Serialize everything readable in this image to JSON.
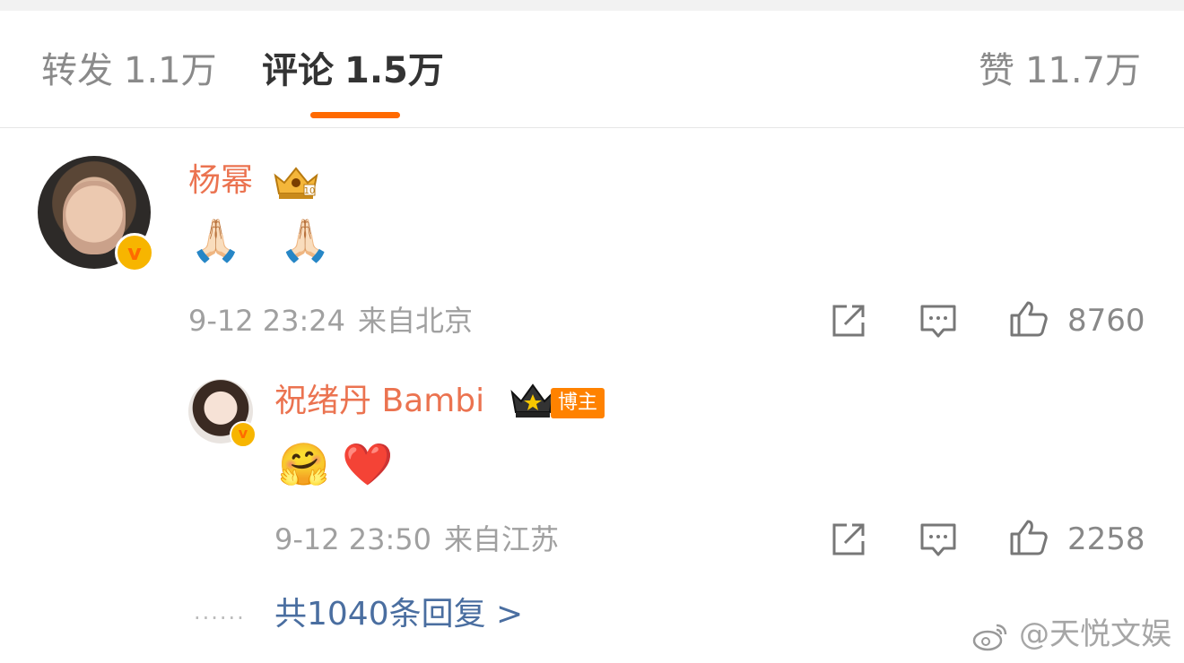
{
  "tabs": {
    "repost": {
      "label": "转发",
      "count": "1.1万"
    },
    "comment": {
      "label": "评论",
      "count": "1.5万"
    },
    "like": {
      "label": "赞",
      "count": "11.7万"
    }
  },
  "accent_color": "#ff6a00",
  "comment": {
    "username": "杨幂",
    "content_emoji": "🙏🏻 🙏🏻",
    "date": "9-12 23:24",
    "location": "来自北京",
    "likes": "8760",
    "reply": {
      "username": "祝绪丹 Bambi",
      "badge": "博主",
      "content_emoji": "🤗",
      "heart": "❤️",
      "date": "9-12 23:50",
      "location": "来自江苏",
      "likes": "2258"
    },
    "more_replies": "共1040条回复 >"
  },
  "watermark": "@天悦文娱",
  "icons": [
    "share-icon",
    "comment-icon",
    "like-icon",
    "crown-icon",
    "verified-badge-icon",
    "weibo-logo-icon"
  ]
}
